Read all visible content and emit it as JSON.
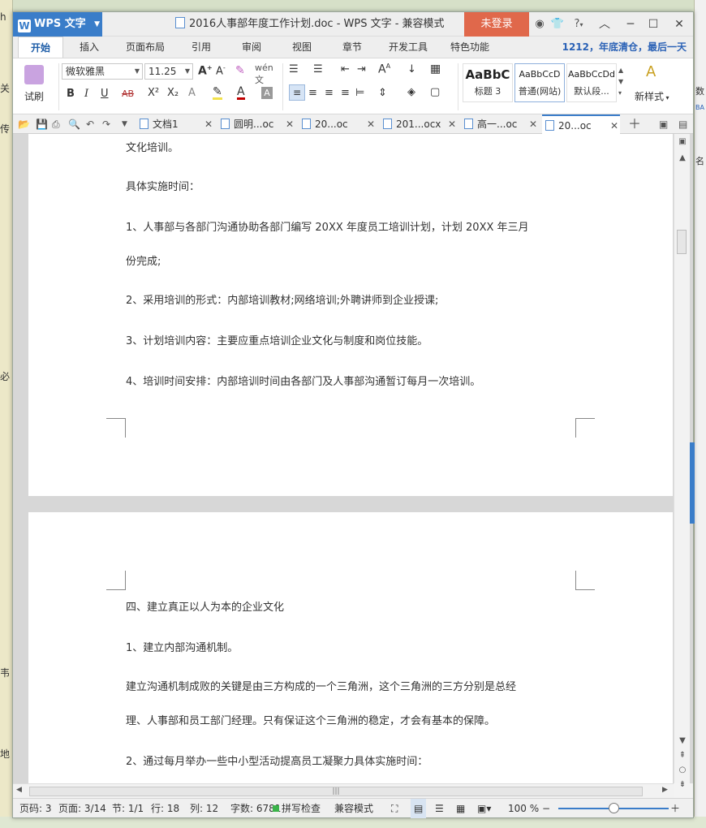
{
  "background": {
    "left_texts": [
      "h",
      "关",
      "传",
      "必",
      "韦",
      "地"
    ],
    "right_texts": [
      "名",
      "数",
      "BA"
    ]
  },
  "titlebar": {
    "app_name": "WPS 文字",
    "title": "2016人事部年度工作计划.doc - WPS 文字 - 兼容模式",
    "login": "未登录",
    "help": "?",
    "colors": {
      "app": "#3a7dc9",
      "login": "#e0684b"
    }
  },
  "menu": {
    "tabs": [
      "开始",
      "插入",
      "页面布局",
      "引用",
      "审阅",
      "视图",
      "章节",
      "开发工具",
      "特色功能"
    ],
    "active": "开始",
    "notice": "1212，年底清仓，最后一天"
  },
  "ribbon": {
    "format_painter": "试刷",
    "font_name": "微软雅黑",
    "font_size": "11.25",
    "bold": "B",
    "italic": "I",
    "underline": "U",
    "strike": "AB",
    "superscript": "X²",
    "subscript": "X₂",
    "styles": [
      {
        "preview": "AaBbC",
        "label": "标题 3"
      },
      {
        "preview": "AaBbCcD",
        "label": "普通(网站)"
      },
      {
        "preview": "AaBbCcDd",
        "label": "默认段..."
      }
    ],
    "new_style": "新样式"
  },
  "doc_tabs": [
    {
      "label": "文档1",
      "active": false
    },
    {
      "label": "圆明...oc",
      "active": false
    },
    {
      "label": "20...oc",
      "active": false
    },
    {
      "label": "201...ocx",
      "active": false
    },
    {
      "label": "高一...oc",
      "active": false
    },
    {
      "label": "20...oc",
      "active": true
    }
  ],
  "page1": {
    "lines": [
      "文化培训。",
      "具体实施时间：",
      "1、人事部与各部门沟通协助各部门编写 20XX 年度员工培训计划，计划 20XX 年三月",
      "份完成;",
      "2、采用培训的形式：内部培训教材;网络培训;外聘讲师到企业授课;",
      "3、计划培训内容：主要应重点培训企业文化与制度和岗位技能。",
      "4、培训时间安排：内部培训时间由各部门及人事部沟通暂订每月一次培训。"
    ]
  },
  "page2": {
    "lines": [
      "四、建立真正以人为本的企业文化",
      "1、建立内部沟通机制。",
      "建立沟通机制成败的关键是由三方构成的一个三角洲，这个三角洲的三方分别是总经",
      "理、人事部和员工部门经理。只有保证这个三角洲的稳定，才会有基本的保障。",
      "2、通过每月举办一些中小型活动提高员工凝聚力具体实施时间："
    ]
  },
  "statusbar": {
    "page_num": "页码: 3",
    "pages": "页面: 3/14",
    "section": "节: 1/1",
    "row": "行: 18",
    "col": "列: 12",
    "words": "字数: 6781",
    "spell": "拼写检查",
    "mode": "兼容模式",
    "zoom": "100 %",
    "zoom_level": 0.5
  }
}
